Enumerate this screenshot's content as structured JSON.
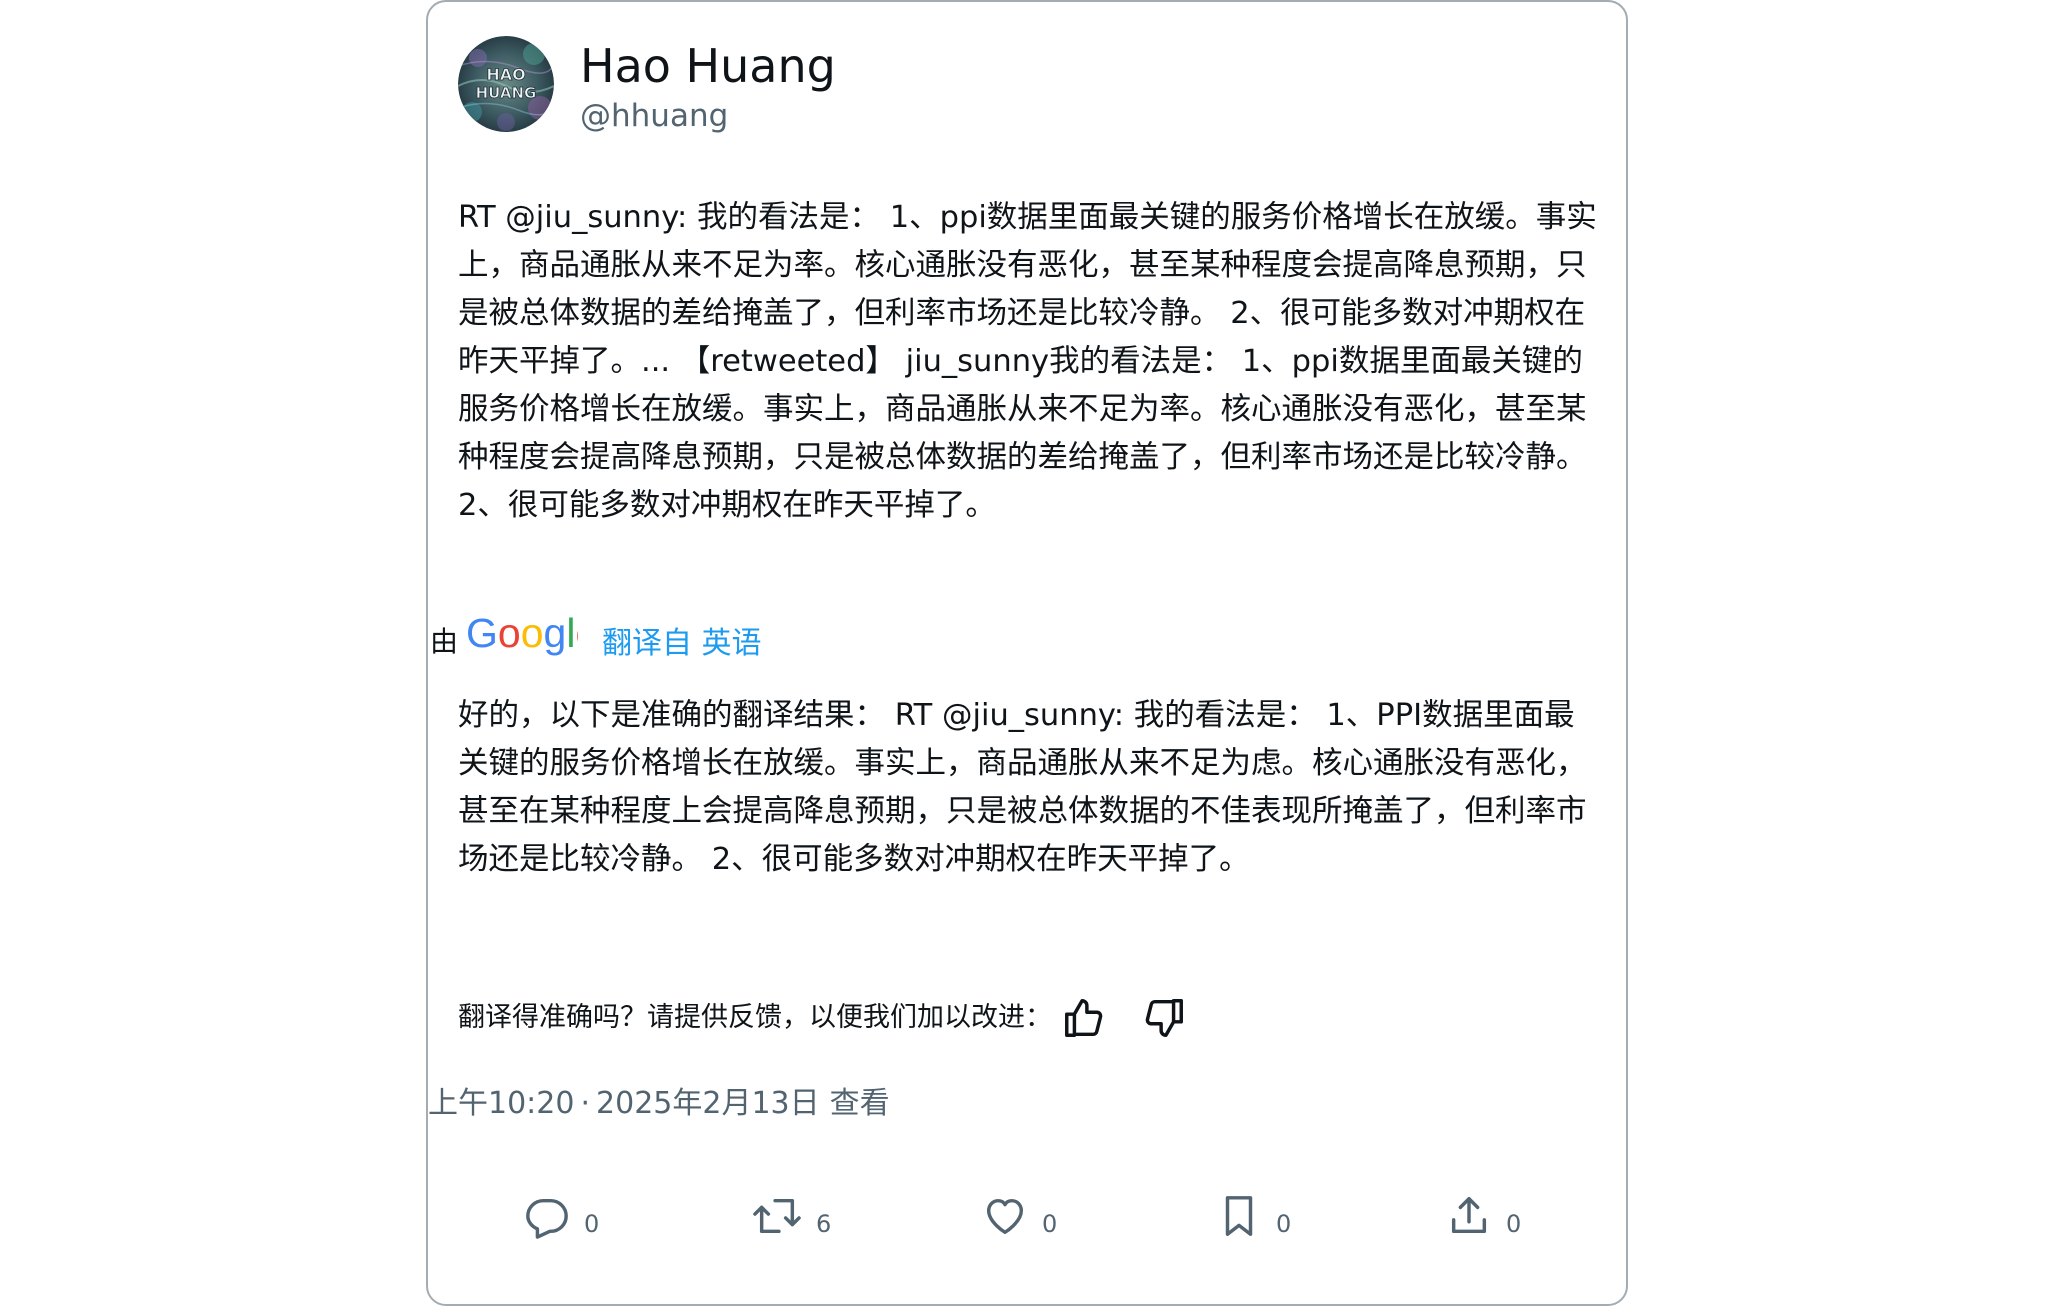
{
  "user": {
    "avatar_text": [
      "HAO",
      "HUANG"
    ],
    "display_name": "Hao Huang",
    "handle": "@hhuang"
  },
  "tweet": {
    "text": "RT @jiu_sunny: 我的看法是： 1、ppi数据里面最关键的服务价格增长在放缓。事实上，商品通胀从来不足为率。核心通胀没有恶化，甚至某种程度会提高降息预期，只是被总体数据的差给掩盖了，但利率市场还是比较冷静。 2、很可能多数对冲期权在昨天平掉了。... 【retweeted】 jiu_sunny我的看法是： 1、ppi数据里面最关键的服务价格增长在放缓。事实上，商品通胀从来不足为率。核心通胀没有恶化，甚至某种程度会提高降息预期，只是被总体数据的差给掩盖了，但利率市场还是比较冷静。 2、很可能多数对冲期权在昨天平掉了。"
  },
  "translation": {
    "by": "由",
    "provider": "Google",
    "source_link": "翻译自 英语",
    "text": "好的，以下是准确的翻译结果： RT @jiu_sunny: 我的看法是： 1、PPI数据里面最关键的服务价格增长在放缓。事实上，商品通胀从来不足为虑。核心通胀没有恶化，甚至在某种程度上会提高降息预期，只是被总体数据的不佳表现所掩盖了，但利率市场还是比较冷静。 2、很可能多数对冲期权在昨天平掉了。",
    "feedback_prompt": "翻译得准确吗？请提供反馈，以便我们加以改进："
  },
  "meta": {
    "time": "上午10:20",
    "separator": "·",
    "date": "2025年2月13日",
    "view_link": "查看"
  },
  "actions": {
    "reply_count": "0",
    "retweet_count": "6",
    "like_count": "0",
    "bookmark_count": "0",
    "share_count": "0"
  },
  "colors": {
    "text": "#0f1419",
    "secondary": "#536471",
    "link": "#1d9bf0",
    "border": "#a3abb3"
  }
}
